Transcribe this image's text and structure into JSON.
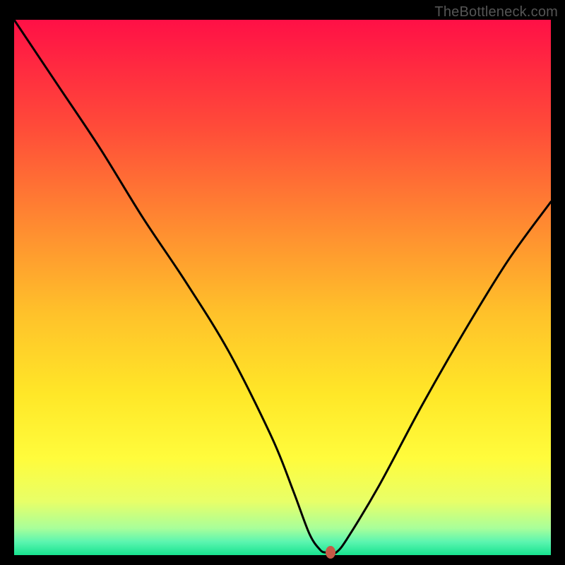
{
  "watermark": {
    "text": "TheBottleneck.com"
  },
  "chart_data": {
    "type": "line",
    "title": "",
    "xlabel": "",
    "ylabel": "",
    "xlim": [
      0,
      100
    ],
    "ylim": [
      0,
      100
    ],
    "series": [
      {
        "name": "bottleneck-curve",
        "x": [
          0,
          8,
          16,
          24,
          32,
          40,
          48,
          52,
          55,
          57,
          58,
          59,
          60,
          62,
          68,
          76,
          84,
          92,
          100
        ],
        "y": [
          100,
          88,
          76,
          63,
          51,
          38,
          22,
          12,
          4,
          1,
          0.5,
          0.5,
          0.5,
          3,
          13,
          28,
          42,
          55,
          66
        ]
      }
    ],
    "marker": {
      "x": 59,
      "y": 0.5,
      "color": "#c65a47"
    },
    "gradient": {
      "stops": [
        {
          "offset": 0.0,
          "color": "#ff1046"
        },
        {
          "offset": 0.2,
          "color": "#ff4b39"
        },
        {
          "offset": 0.4,
          "color": "#ff9030"
        },
        {
          "offset": 0.55,
          "color": "#ffc22a"
        },
        {
          "offset": 0.7,
          "color": "#ffe728"
        },
        {
          "offset": 0.82,
          "color": "#fffc3c"
        },
        {
          "offset": 0.9,
          "color": "#e8ff68"
        },
        {
          "offset": 0.95,
          "color": "#a8ff9a"
        },
        {
          "offset": 0.975,
          "color": "#5cf5b0"
        },
        {
          "offset": 1.0,
          "color": "#17e38f"
        }
      ]
    }
  }
}
